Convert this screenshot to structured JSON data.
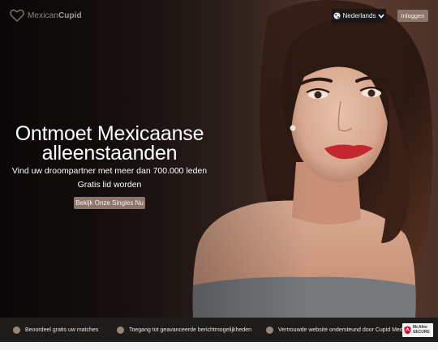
{
  "brand": {
    "name_part1": "Mexican",
    "name_part2": "Cupid"
  },
  "header": {
    "language_label": "Nederlands",
    "login_label": "Inloggen"
  },
  "hero": {
    "headline_line1": "Ontmoet Mexicaanse",
    "headline_line2": "alleenstaanden",
    "subline": "Vind uw droompartner met meer dan 700.000 leden",
    "free_line": "Gratis lid worden",
    "cta_label": "Bekijk Onze Singles Nu"
  },
  "features": [
    {
      "label": "Beoordeel gratis uw matches"
    },
    {
      "label": "Toegang tot geavanceerde berichtmogelijkheden"
    },
    {
      "label": "Vertrouwde website ondersteund door Cupid Media"
    }
  ],
  "badge": {
    "line1": "McAfee",
    "line2": "SECURE"
  },
  "colors": {
    "accent": "#8c7669",
    "feature_dot": "#9a8474",
    "footer_bg": "#1d1c1b"
  },
  "icons": [
    "heart-logo-icon",
    "globe-icon",
    "chevron-down-icon",
    "mcafee-shield-icon"
  ]
}
